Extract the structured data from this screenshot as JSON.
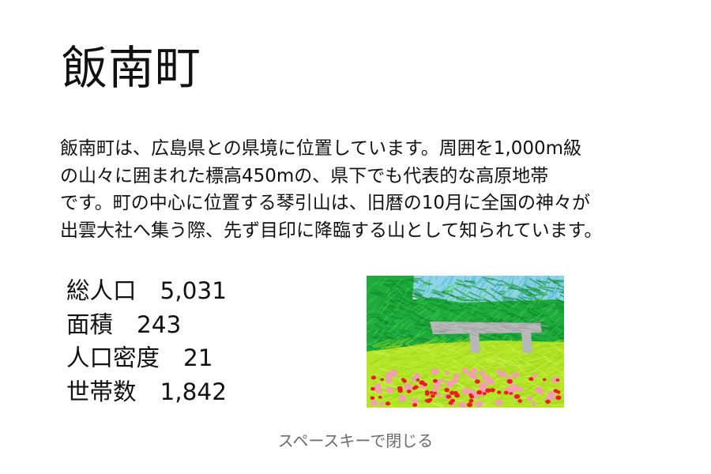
{
  "title": "飯南町",
  "description_lines": [
    "飯南町は、広島県との県境に位置しています。周囲を1,000m級",
    "の山々に囲まれた標高450mの、県下でも代表的な高原地帯",
    "です。町の中心に位置する琴引山は、旧暦の10月に全国の神々が",
    "出雲大社へ集う際、先ず目印に降臨する山として知られています。"
  ],
  "stats": [
    {
      "label": "総人口",
      "value": "5,031"
    },
    {
      "label": "面積",
      "value": "243"
    },
    {
      "label": "人口密度",
      "value": "21"
    },
    {
      "label": "世帯数",
      "value": "1,842"
    }
  ],
  "hint": "スペースキーで閉じる",
  "colors": {
    "sky": "#8fd3e8",
    "trees": "#1faa3c",
    "meadow": "#b5e62a",
    "bridge": "#b8b8b8",
    "flowers_pink": "#f29fb0",
    "flowers_red": "#ee1c1c",
    "hint_text": "#6b6b6b"
  }
}
